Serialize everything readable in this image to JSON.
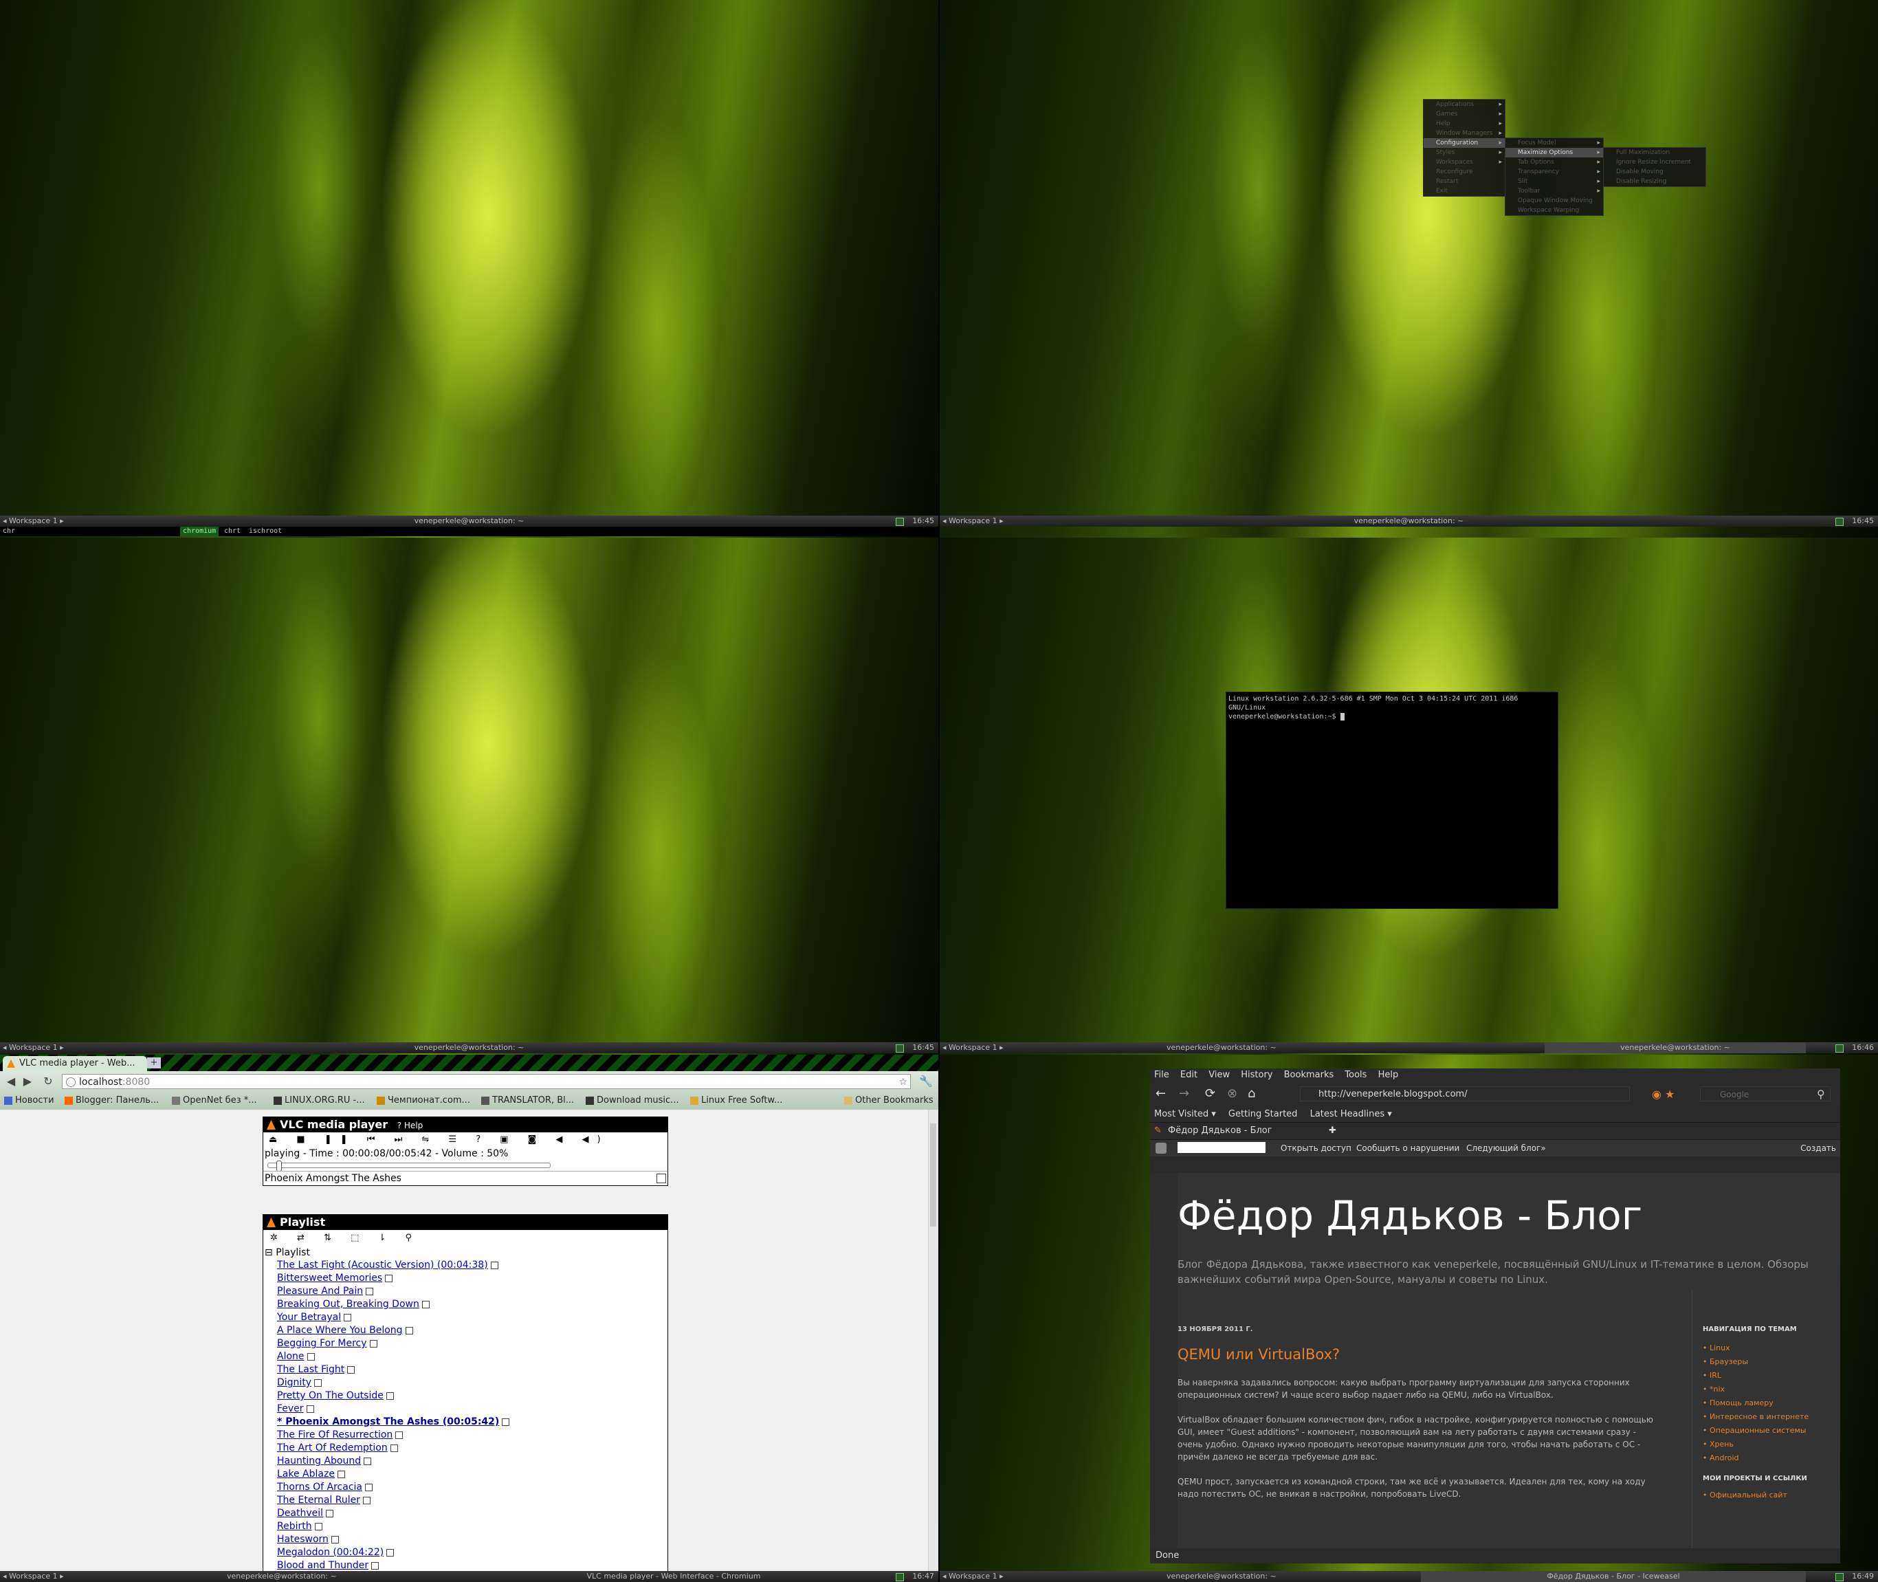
{
  "panels": {
    "workspace_label": "Workspace 1",
    "title_tl": "veneperkele@workstation: ~",
    "title_tr": "veneperkele@workstation: ~",
    "title_ml_center": "veneperkele@workstation: ~",
    "title_mr_left": "veneperkele@workstation: ~",
    "title_mr_right": "veneperkele@workstation: ~",
    "title_bl_left": "veneperkele@workstation: ~",
    "title_bl_right": "VLC media player - Web Interface - Chromium",
    "title_br_left": "veneperkele@workstation: ~",
    "title_br_right": "Фёдор Дядьков - Блог - Iceweasel",
    "clock_tl": "16:45",
    "clock_tr": "16:45",
    "clock_ml": "16:45",
    "clock_mr": "16:46",
    "clock_bl": "16:47",
    "clock_br": "16:49"
  },
  "dmenu": {
    "input": "chr",
    "sel": "chromium",
    "opt2": "chrt",
    "opt3": "ischroot"
  },
  "root_menu": {
    "items": [
      "Applications",
      "Games",
      "Help",
      "Window Managers",
      "Configuration",
      "Styles",
      "Workspaces",
      "Reconfigure",
      "Restart",
      "Exit"
    ]
  },
  "config_menu": {
    "items": [
      "Focus Model",
      "Maximize Options",
      "Tab Options",
      "Transparency",
      "Slit",
      "Toolbar",
      "Opaque Window Moving",
      "Workspace Warping"
    ]
  },
  "max_menu": {
    "items": [
      "Full Maximization",
      "Ignore Resize Increment",
      "Disable Moving",
      "Disable Resizing"
    ]
  },
  "terminal": {
    "line1": "Linux workstation 2.6.32-5-686 #1 SMP Mon Oct 3 04:15:24 UTC 2011 i686 GNU/Linux",
    "prompt": "veneperkele@workstation:~$ "
  },
  "chromium": {
    "tab_title": "VLC media player - Web...",
    "url_host": "localhost",
    "url_port": ":8080",
    "bookmarks": [
      "Новости",
      "Blogger: Панель...",
      "OpenNet без *...",
      "LINUX.ORG.RU -...",
      "Чемпионат.com...",
      "TRANSLATOR, Bl...",
      "Download music...",
      "Linux Free Softw..."
    ],
    "other_bookmarks": "Other Bookmarks"
  },
  "vlc": {
    "title": "VLC media player",
    "help": "Help",
    "controls": "⏏ ■ ❚❚ ⏮ ⏭ ⇋ ☰ ?  ▣ ◙ ◀ ◀)",
    "status": "playing - Time : 00:00:08/00:05:42 - Volume : 50%",
    "track": "Phoenix Amongst The Ashes",
    "volume_fraction": 0.5,
    "position_fraction": 0.023,
    "playlist_title": "Playlist",
    "playlist_root": "Playlist",
    "tools": "✲ ⇄ ⇅ ⬚ ⇂ ⚲",
    "tracks": [
      "The Last Fight (Acoustic Version) (00:04:38)",
      "Bittersweet Memories",
      "Pleasure And Pain",
      "Breaking Out, Breaking Down",
      "Your Betrayal",
      "A Place Where You Belong",
      "Begging For Mercy",
      "Alone",
      "The Last Fight",
      "Dignity",
      "Pretty On The Outside",
      "Fever",
      "* Phoenix Amongst The Ashes (00:05:42)",
      "The Fire Of Resurrection",
      "The Art Of Redemption",
      "Haunting Abound",
      "Lake Ablaze",
      "Thorns Of Arcacia",
      "The Eternal Ruler",
      "Deathveil",
      "Rebirth",
      "Hatesworn",
      "Megalodon (00:04:22)",
      "Blood and Thunder"
    ]
  },
  "iceweasel": {
    "menu": [
      "File",
      "Edit",
      "View",
      "History",
      "Bookmarks",
      "Tools",
      "Help"
    ],
    "url": "http://veneperkele.blogspot.com/",
    "search_engine": "Google",
    "bookmarks": [
      "Most Visited ▾",
      "Getting Started",
      "Latest Headlines ▾"
    ],
    "tab": "Фёдор Дядьков - Блог",
    "blogger_links": [
      "Открыть доступ",
      "Сообщить о нарушении",
      "Следующий блог»"
    ],
    "blogger_create": "Создать",
    "blog_title": "Фёдор Дядьков - Блог",
    "blog_desc": "Блог Фёдора Дядькова, также известного как veneperkele, посвящённый GNU/Linux и IT-тематике в целом. Обзоры важнейших событий мира Open-Source, мануалы и советы по Linux.",
    "post_date": "13 НОЯБРЯ 2011 Г.",
    "post_title": "QEMU или VirtualBox?",
    "para1": "Вы наверняка задавались вопросом: какую выбрать программу виртуализации для запуска сторонних операционных систем? И чаще всего выбор падает либо на QEMU, либо на VirtualBox.",
    "para2": "VirtualBox обладает большим количеством фич, гибок в настройке, конфигурируется полностью с помощью GUI, имеет \"Guest additions\" - компонент, позволяющий вам на лету работать с двумя системами сразу - очень удобно. Однако нужно проводить некоторые манипуляции для того, чтобы начать работать с ОС - причём далеко не всегда требуемые для вас.",
    "para3": "QEMU прост, запускается из командной строки, там же всё и указывается. Идеален для тех, кому на ходу надо потестить ОС, не вникая в настройки, попробовать LiveCD.",
    "nav_heading": "НАВИГАЦИЯ ПО ТЕМАМ",
    "nav_items": [
      "Linux",
      "Браузеры",
      "IRL",
      "*nix",
      "Помощь ламеру",
      "Интересное в интернете",
      "Операционные системы",
      "Хрень",
      "Android"
    ],
    "proj_heading": "МОИ ПРОЕКТЫ И ССЫЛКИ",
    "proj_items": [
      "Официальный сайт"
    ],
    "status": "Done"
  },
  "colors": {
    "accent_orange": "#e8822a",
    "panel_bg": "#2a2a2a",
    "dmenu_sel": "#1a5a1a"
  }
}
